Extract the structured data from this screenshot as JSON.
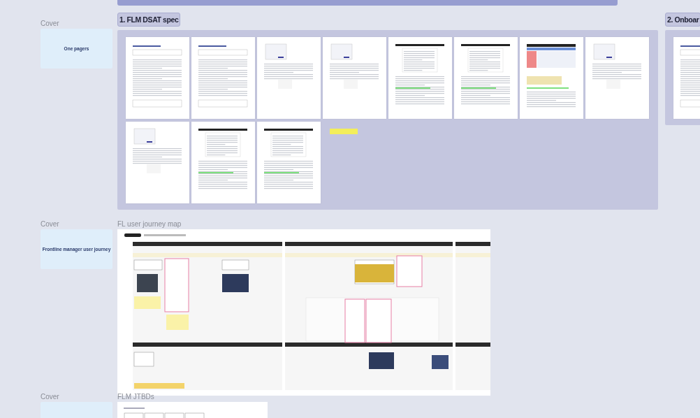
{
  "rows": [
    {
      "cover": {
        "label": "Cover",
        "title": "One pagers"
      },
      "board": {
        "kind": "sections",
        "sections": [
          {
            "title": "1. FLM DSAT spec",
            "pages": [
              {
                "kind": "text"
              },
              {
                "kind": "text"
              },
              {
                "kind": "figure"
              },
              {
                "kind": "figure"
              },
              {
                "kind": "table"
              },
              {
                "kind": "table"
              },
              {
                "kind": "spreadsheet"
              },
              {
                "kind": "figure"
              },
              {
                "kind": "figure"
              },
              {
                "kind": "table"
              },
              {
                "kind": "table"
              },
              {
                "kind": "sticky"
              }
            ]
          },
          {
            "title": "2. Onboar",
            "pages": [
              {
                "kind": "text"
              }
            ]
          }
        ]
      }
    },
    {
      "cover": {
        "label": "Cover",
        "title": "Frontline manager user journey"
      },
      "board": {
        "kind": "journey-frame",
        "title": "FL user journey map"
      }
    },
    {
      "cover": {
        "label": "Cover"
      },
      "board": {
        "kind": "jtbd-frame",
        "title": "FLM JTBDs"
      }
    }
  ]
}
